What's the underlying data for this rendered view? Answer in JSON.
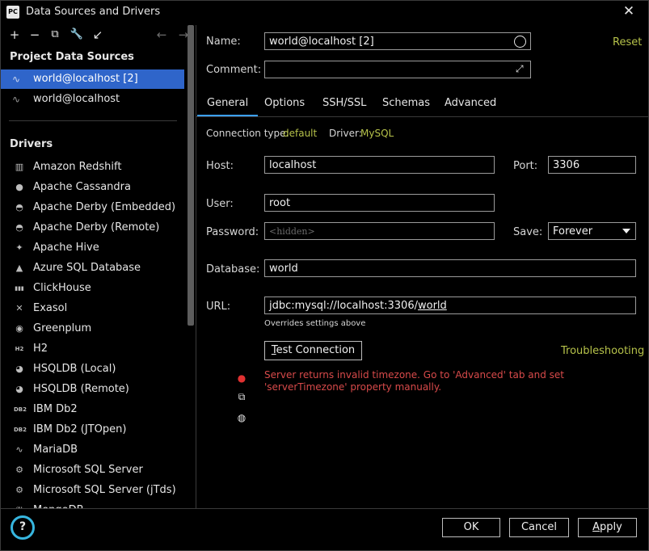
{
  "window": {
    "app_icon_text": "PC",
    "title": "Data Sources and Drivers"
  },
  "left": {
    "toolbar": [
      "+",
      "−",
      "⧉",
      "🔧",
      "↙",
      "←",
      "→"
    ],
    "project_title": "Project Data Sources",
    "data_sources": [
      {
        "label": "world@localhost [2]",
        "selected": true
      },
      {
        "label": "world@localhost",
        "selected": false
      }
    ],
    "drivers_title": "Drivers",
    "drivers": [
      {
        "label": "Amazon Redshift",
        "icon": "▥"
      },
      {
        "label": "Apache Cassandra",
        "icon": "●"
      },
      {
        "label": "Apache Derby (Embedded)",
        "icon": "◓"
      },
      {
        "label": "Apache Derby (Remote)",
        "icon": "◓"
      },
      {
        "label": "Apache Hive",
        "icon": "✦"
      },
      {
        "label": "Azure SQL Database",
        "icon": "▲"
      },
      {
        "label": "ClickHouse",
        "icon": "▮▮▮"
      },
      {
        "label": "Exasol",
        "icon": "✕"
      },
      {
        "label": "Greenplum",
        "icon": "◉"
      },
      {
        "label": "H2",
        "icon": "H2"
      },
      {
        "label": "HSQLDB (Local)",
        "icon": "◕"
      },
      {
        "label": "HSQLDB (Remote)",
        "icon": "◕"
      },
      {
        "label": "IBM Db2",
        "icon": "DB2"
      },
      {
        "label": "IBM Db2 (JTOpen)",
        "icon": "DB2"
      },
      {
        "label": "MariaDB",
        "icon": "∿"
      },
      {
        "label": "Microsoft SQL Server",
        "icon": "⚙"
      },
      {
        "label": "Microsoft SQL Server (jTds)",
        "icon": "⚙"
      },
      {
        "label": "MongoDB",
        "icon": "❦"
      }
    ]
  },
  "form": {
    "name_label": "Name:",
    "name_value": "world@localhost [2]",
    "comment_label": "Comment:",
    "comment_value": "",
    "reset_label": "Reset",
    "tabs": [
      "General",
      "Options",
      "SSH/SSL",
      "Schemas",
      "Advanced"
    ],
    "active_tab": "General",
    "conn_type_label": "Connection type:",
    "conn_type_value": "default",
    "driver_label": "Driver:",
    "driver_value": "MySQL",
    "host_label": "Host:",
    "host_value": "localhost",
    "port_label": "Port:",
    "port_value": "3306",
    "user_label": "User:",
    "user_value": "root",
    "password_label": "Password:",
    "password_placeholder": "<hidden>",
    "save_label": "Save:",
    "save_value": "Forever",
    "database_label": "Database:",
    "database_value": "world",
    "url_label": "URL:",
    "url_prefix": "jdbc:mysql://localhost:3306/",
    "url_db": "world",
    "url_hint": "Overrides settings above",
    "test_button_first": "T",
    "test_button_rest": "est Connection",
    "troubleshooting": "Troubleshooting",
    "error_message": "Server returns invalid timezone. Go to 'Advanced' tab and set 'serverTimezone' property manually."
  },
  "footer": {
    "help": "?",
    "ok": "OK",
    "cancel": "Cancel",
    "apply_first": "A",
    "apply_rest": "pply"
  },
  "colors": {
    "accent": "#3ba0ff",
    "selection": "#2f65ca",
    "link": "#b6c24a",
    "error": "#d84a4a"
  }
}
